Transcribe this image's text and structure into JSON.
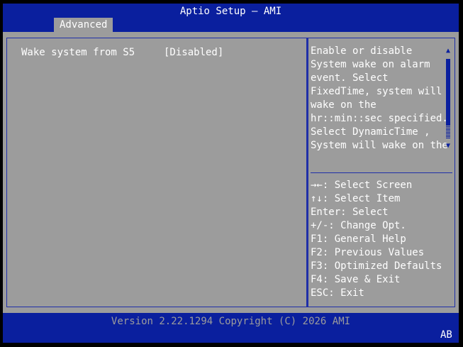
{
  "header": {
    "title": "Aptio Setup – AMI",
    "active_tab": "Advanced"
  },
  "settings": [
    {
      "label": "Wake system from S5",
      "value": "[Disabled]"
    }
  ],
  "help": {
    "lines": [
      "Enable or disable",
      "System wake on alarm",
      "event. Select",
      "FixedTime, system will",
      "wake on the",
      "hr::min::sec specified.",
      "Select DynamicTime ,",
      "System will wake on the"
    ],
    "scroll_up_icon": "triangle-up-icon",
    "scroll_down_icon": "triangle-down-icon"
  },
  "keys": [
    "→←: Select Screen",
    "↑↓: Select Item",
    "Enter: Select",
    "+/-: Change Opt.",
    "F1: General Help",
    "F2: Previous Values",
    "F3: Optimized Defaults",
    "F4: Save & Exit",
    "ESC: Exit"
  ],
  "footer": {
    "version": "Version 2.22.1294 Copyright (C) 2026 AMI",
    "corner": "AB"
  },
  "colors": {
    "background": "#9c9c9c",
    "bar": "#0a1f9e",
    "text": "#ffffff",
    "footer_text": "#9c9c9c"
  }
}
